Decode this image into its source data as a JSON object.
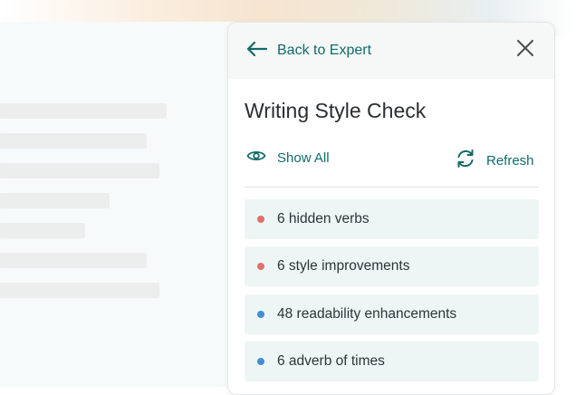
{
  "panel": {
    "back_label": "Back to Expert",
    "title": "Writing Style Check",
    "show_all_label": "Show All",
    "refresh_label": "Refresh"
  },
  "issues": [
    {
      "label": "6 hidden verbs",
      "dot_color": "#e0706a"
    },
    {
      "label": "6 style improvements",
      "dot_color": "#e0706a"
    },
    {
      "label": "48 readability enhancements",
      "dot_color": "#3d8fe0"
    },
    {
      "label": "6 adverb of times",
      "dot_color": "#3d8fe0"
    }
  ],
  "colors": {
    "accent": "#116b69",
    "issue_bg": "#eef6f5"
  }
}
